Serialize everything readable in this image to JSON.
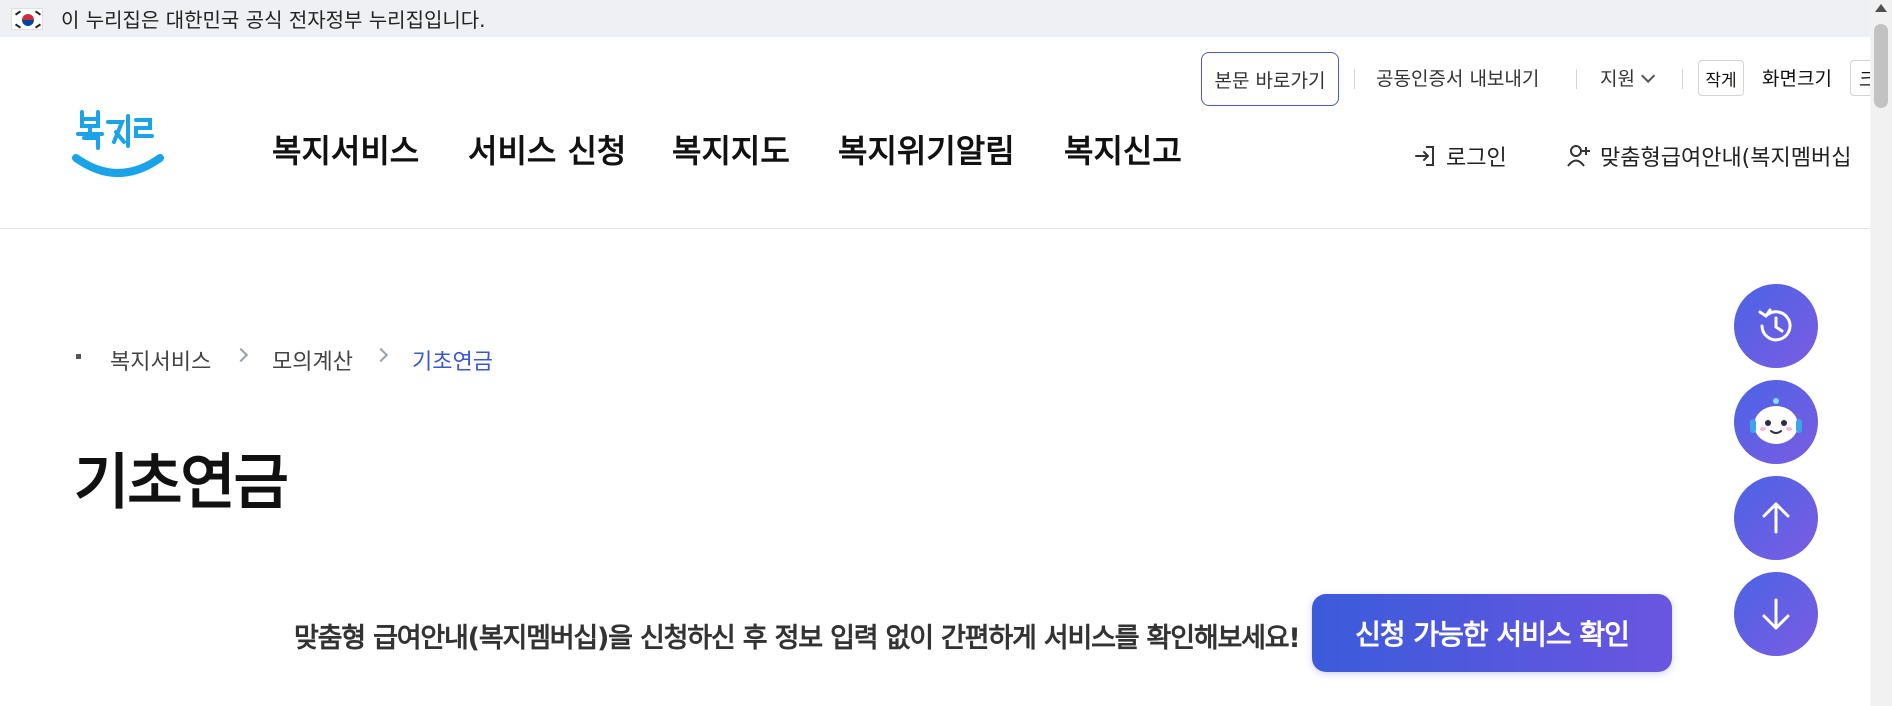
{
  "gov_banner": {
    "text": "이 누리집은 대한민국 공식 전자정부 누리집입니다.",
    "flag_icon": "korea-flag-icon"
  },
  "utility": {
    "skip_to_content": "본문 바로가기",
    "certificate_export": "공동인증서 내보내기",
    "support": "지원",
    "font_small": "작게",
    "font_size_label": "화면크기",
    "font_large": "크"
  },
  "logo": {
    "text": "복지로",
    "brand_color": "#1aa3e8"
  },
  "gnb": {
    "items": [
      {
        "label": "복지서비스"
      },
      {
        "label": "서비스 신청"
      },
      {
        "label": "복지지도"
      },
      {
        "label": "복지위기알림"
      },
      {
        "label": "복지신고"
      }
    ]
  },
  "header_actions": {
    "login": "로그인",
    "member_service": "맞춤형급여안내(복지멤버십"
  },
  "breadcrumb": {
    "items": [
      "복지서비스",
      "모의계산",
      "기초연금"
    ]
  },
  "page": {
    "title": "기초연금"
  },
  "promo": {
    "text": "맞춤형 급여안내(복지멤버십)을 신청하신 후 정보 입력 없이 간편하게 서비스를 확인해보세요!",
    "button": "신청 가능한 서비스 확인"
  },
  "quick_menu": {
    "items": [
      "history-icon",
      "chatbot-icon",
      "scroll-top-icon",
      "scroll-bottom-icon"
    ]
  },
  "colors": {
    "accent": "#3b57d4",
    "gradient_start": "#3b5bdb",
    "gradient_end": "#7b5ce2"
  }
}
